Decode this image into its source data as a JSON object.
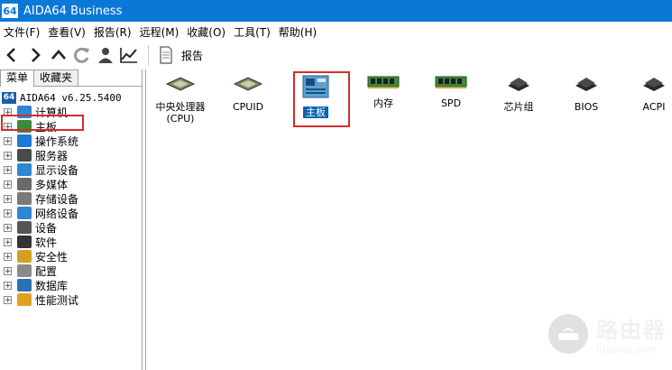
{
  "window": {
    "title": "AIDA64 Business",
    "logo_text": "64"
  },
  "menubar": [
    {
      "label": "文件(F)"
    },
    {
      "label": "查看(V)"
    },
    {
      "label": "报告(R)"
    },
    {
      "label": "远程(M)"
    },
    {
      "label": "收藏(O)"
    },
    {
      "label": "工具(T)"
    },
    {
      "label": "帮助(H)"
    }
  ],
  "toolbar": {
    "icons": [
      "back-icon",
      "forward-icon",
      "up-icon",
      "refresh-icon",
      "user-icon",
      "chart-icon"
    ],
    "report_label": "报告"
  },
  "left_panel": {
    "tabs": [
      {
        "label": "菜单"
      },
      {
        "label": "收藏夹"
      }
    ],
    "root_label": "AIDA64 v6.25.5400",
    "items": [
      {
        "label": "计算机",
        "icon": "computer-icon",
        "color": "#2f87d4"
      },
      {
        "label": "主板",
        "icon": "motherboard-icon",
        "color": "#3a8a3a"
      },
      {
        "label": "操作系统",
        "icon": "windows-icon",
        "color": "#1e78d6"
      },
      {
        "label": "服务器",
        "icon": "server-icon",
        "color": "#4a4a4a"
      },
      {
        "label": "显示设备",
        "icon": "display-icon",
        "color": "#2f87d4"
      },
      {
        "label": "多媒体",
        "icon": "speaker-icon",
        "color": "#6a6a6a"
      },
      {
        "label": "存储设备",
        "icon": "storage-icon",
        "color": "#7a7a7a"
      },
      {
        "label": "网络设备",
        "icon": "network-icon",
        "color": "#2f87d4"
      },
      {
        "label": "设备",
        "icon": "device-icon",
        "color": "#555555"
      },
      {
        "label": "软件",
        "icon": "software-icon",
        "color": "#333333"
      },
      {
        "label": "安全性",
        "icon": "shield-icon",
        "color": "#d4a020"
      },
      {
        "label": "配置",
        "icon": "config-icon",
        "color": "#8a8a8a"
      },
      {
        "label": "数据库",
        "icon": "database-icon",
        "color": "#2f6fb4"
      },
      {
        "label": "性能测试",
        "icon": "benchmark-icon",
        "color": "#e0a020"
      }
    ]
  },
  "right_panel": {
    "items": [
      {
        "label": "中央处理器",
        "label2": "(CPU)",
        "icon": "cpu-icon"
      },
      {
        "label": "CPUID",
        "icon": "cpuid-icon"
      },
      {
        "label": "主板",
        "icon": "motherboard-icon",
        "selected": true
      },
      {
        "label": "内存",
        "icon": "memory-icon"
      },
      {
        "label": "SPD",
        "icon": "spd-icon"
      },
      {
        "label": "芯片组",
        "icon": "chipset-icon"
      },
      {
        "label": "BIOS",
        "icon": "bios-icon"
      },
      {
        "label": "ACPI",
        "icon": "acpi-icon"
      }
    ]
  },
  "watermark": {
    "text": "路由器",
    "subtext": "luyouqi.com"
  },
  "colors": {
    "titlebar": "#0a78d7",
    "highlight_box": "#d32c2c",
    "selection": "#0a64b4"
  }
}
